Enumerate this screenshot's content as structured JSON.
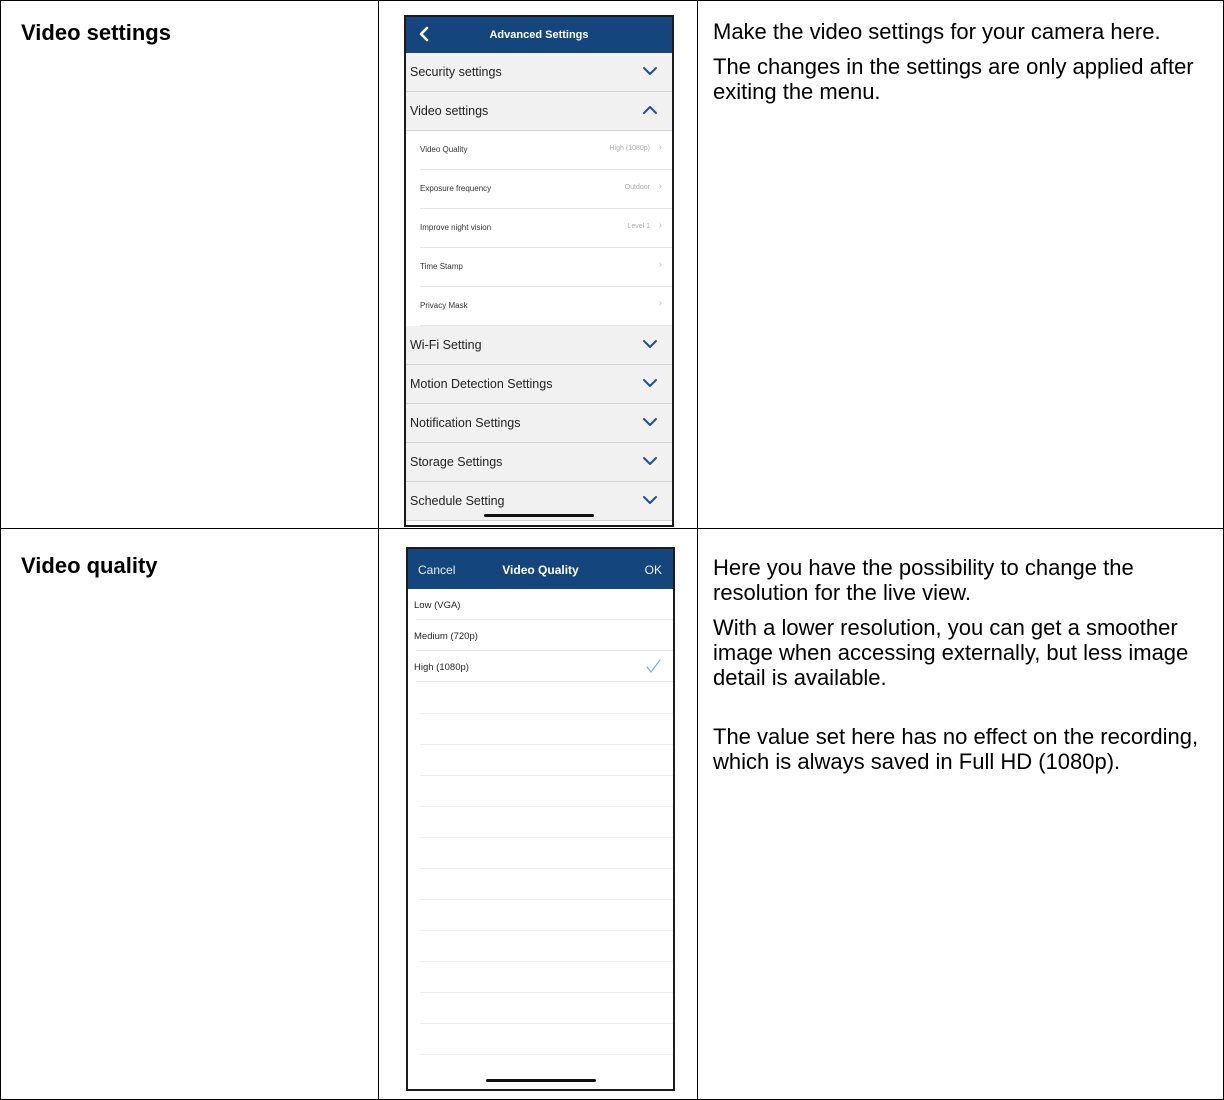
{
  "rows": [
    {
      "heading": "Video settings",
      "description": [
        "Make the video settings for your camera here.",
        "The changes in the settings are only applied after exiting the menu."
      ],
      "phone": {
        "title": "Advanced Settings",
        "sections_before": [
          {
            "label": "Security settings",
            "state": "collapsed"
          },
          {
            "label": "Video settings",
            "state": "expanded"
          }
        ],
        "sub_items": [
          {
            "label": "Video Quality",
            "value": "High (1080p)"
          },
          {
            "label": "Exposure frequency",
            "value": "Outdoor"
          },
          {
            "label": "Improve night vision",
            "value": "Level 1"
          },
          {
            "label": "Time Stamp",
            "value": ""
          },
          {
            "label": "Privacy Mask",
            "value": ""
          }
        ],
        "sections_after": [
          {
            "label": "Wi-Fi Setting",
            "state": "collapsed"
          },
          {
            "label": "Motion Detection Settings",
            "state": "collapsed"
          },
          {
            "label": "Notification Settings",
            "state": "collapsed"
          },
          {
            "label": "Storage Settings",
            "state": "collapsed"
          },
          {
            "label": "Schedule Setting",
            "state": "collapsed"
          }
        ]
      }
    },
    {
      "heading": "Video quality",
      "description": [
        "Here you have the possibility to change the resolution for the live view.",
        "With a lower resolution, you can get a smoother image when accessing externally, but less image detail is available.",
        "The value set here has no effect on the recording, which is always saved in Full HD (1080p)."
      ],
      "phone": {
        "cancel_label": "Cancel",
        "title": "Video Quality",
        "ok_label": "OK",
        "options": [
          "Low (VGA)",
          "Medium (720p)",
          "High (1080p)"
        ],
        "selected_index": 2
      }
    }
  ],
  "colors": {
    "navbar": "#14467d",
    "chevron": "#1f4f8f",
    "section_bg": "#f1f1f1",
    "check": "#7fa8d8"
  },
  "icons": {
    "back": "chevron-left-icon",
    "collapsed": "chevron-down-icon",
    "expanded": "chevron-up-icon",
    "selected": "checkmark-icon"
  }
}
